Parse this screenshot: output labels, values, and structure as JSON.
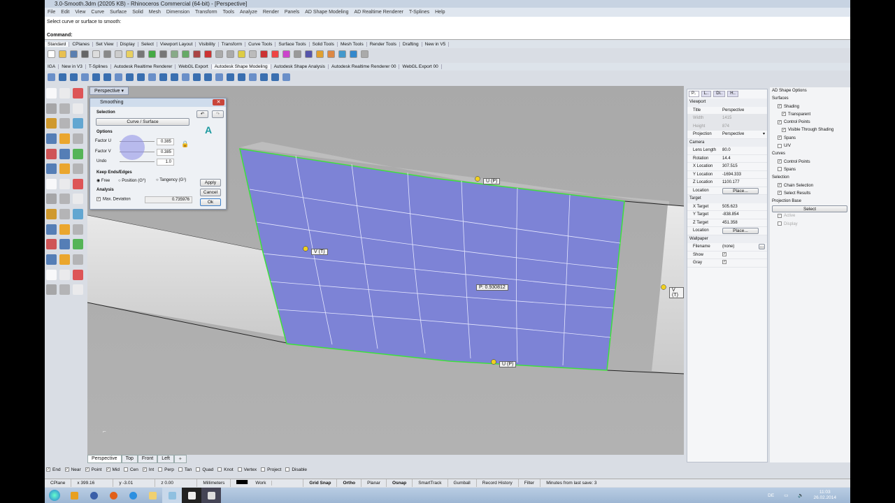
{
  "title": "3.0-Smooth.3dm (20205 KB) - Rhinoceros Commercial (64-bit) - [Perspective]",
  "menu": [
    "File",
    "Edit",
    "View",
    "Curve",
    "Surface",
    "Solid",
    "Mesh",
    "Dimension",
    "Transform",
    "Tools",
    "Analyze",
    "Render",
    "Panels",
    "AD Shape Modeling",
    "AD Realtime Renderer",
    "T-Splines",
    "Help"
  ],
  "command": {
    "prompt": "Select curve or surface to smooth:",
    "label": "Command:"
  },
  "toolbar_tabs": [
    "Standard",
    "CPlanes",
    "Set View",
    "Display",
    "Select",
    "Viewport Layout",
    "Visibility",
    "Transform",
    "Curve Tools",
    "Surface Tools",
    "Solid Tools",
    "Mesh Tools",
    "Render Tools",
    "Drafting",
    "New in V5"
  ],
  "toolbar_tabs2": [
    "IGA",
    "New in V3",
    "T-Splines",
    "Autodesk Realtime Renderer",
    "WebGL Export",
    "Autodesk Shape Modeling",
    "Autodesk Shape Analysis",
    "Autodesk Realtime Renderer 00",
    "WebGL Export 00"
  ],
  "viewport": {
    "title": "Perspective",
    "labels": {
      "u_top": "U (P)",
      "u_bottom": "U (P)",
      "v_left": "V (T)",
      "v_right": "V (T)",
      "center": "P: 0.930812"
    }
  },
  "dialog": {
    "title": "Smoothing",
    "selection": "Selection",
    "curve_surface": "Curve / Surface",
    "options": "Options",
    "factor_u": "Factor U",
    "factor_u_val": "0.385",
    "factor_v": "Factor V",
    "factor_v_val": "0.385",
    "undo": "Undo",
    "undo_val": "1.0",
    "keep": "Keep Ends/Edges",
    "free": "Free",
    "position": "Position (G⁰)",
    "tangency": "Tangency (G¹)",
    "analysis": "Analysis",
    "max_dev": "Max. Deviation",
    "max_dev_val": "0.735976",
    "apply": "Apply",
    "cancel": "Cancel",
    "ok": "Ok"
  },
  "props": {
    "tabs": [
      "P..",
      "L..",
      "Di..",
      "H.."
    ],
    "viewport": "Viewport",
    "title_k": "Title",
    "title_v": "Perspective",
    "width_k": "Width",
    "width_v": "1415",
    "height_k": "Height",
    "height_v": "874",
    "proj_k": "Projection",
    "proj_v": "Perspective",
    "camera": "Camera",
    "lens_k": "Lens Length",
    "lens_v": "80.0",
    "rot_k": "Rotation",
    "rot_v": "14.4",
    "xl_k": "X Location",
    "xl_v": "307.515",
    "yl_k": "Y Location",
    "yl_v": "-1694.333",
    "zl_k": "Z Location",
    "zl_v": "1100.177",
    "loc_k": "Location",
    "place": "Place...",
    "target": "Target",
    "xt_k": "X Target",
    "xt_v": "505.623",
    "yt_k": "Y Target",
    "yt_v": "-838.854",
    "zt_k": "Z Target",
    "zt_v": "451.358",
    "wallpaper": "Wallpaper",
    "fn_k": "Filename",
    "fn_v": "(none)",
    "show_k": "Show",
    "gray_k": "Gray"
  },
  "ad": {
    "title": "AD Shape Options",
    "surfaces": "Surfaces",
    "shading": "Shading",
    "transparent": "Transparent",
    "cp": "Control Points",
    "vts": "Visible Through Shading",
    "spans": "Spans",
    "uv": "U/V",
    "curves": "Curves",
    "ccp": "Control Points",
    "cspans": "Spans",
    "selection": "Selection",
    "chain": "Chain Selection",
    "results": "Select Results",
    "pb": "Projection Base",
    "select": "Select",
    "active": "Active",
    "display": "Display"
  },
  "view_tabs": [
    "Perspective",
    "Top",
    "Front",
    "Left"
  ],
  "osnap": [
    {
      "l": "End",
      "c": true
    },
    {
      "l": "Near",
      "c": true
    },
    {
      "l": "Point",
      "c": true
    },
    {
      "l": "Mid",
      "c": true
    },
    {
      "l": "Cen",
      "c": false
    },
    {
      "l": "Int",
      "c": true
    },
    {
      "l": "Perp",
      "c": false
    },
    {
      "l": "Tan",
      "c": false
    },
    {
      "l": "Quad",
      "c": false
    },
    {
      "l": "Knot",
      "c": false
    },
    {
      "l": "Vertex",
      "c": false
    },
    {
      "l": "Project",
      "c": false
    },
    {
      "l": "Disable",
      "c": false
    }
  ],
  "status": {
    "cplane": "CPlane",
    "x": "x 399.16",
    "y": "y -3.01",
    "z": "z 0.00",
    "units": "Millimeters",
    "layer": "Work",
    "grid": "Grid Snap",
    "ortho": "Ortho",
    "planar": "Planar",
    "osnap": "Osnap",
    "smart": "SmartTrack",
    "gumball": "Gumball",
    "history": "Record History",
    "filter": "Filter",
    "minutes": "Minutes from last save: 3"
  },
  "tray": {
    "lang": "DE",
    "time": "11:03",
    "date": "26.02.2014"
  },
  "colors": {
    "surface": "#7d83d6",
    "edge": "#3de03d"
  }
}
